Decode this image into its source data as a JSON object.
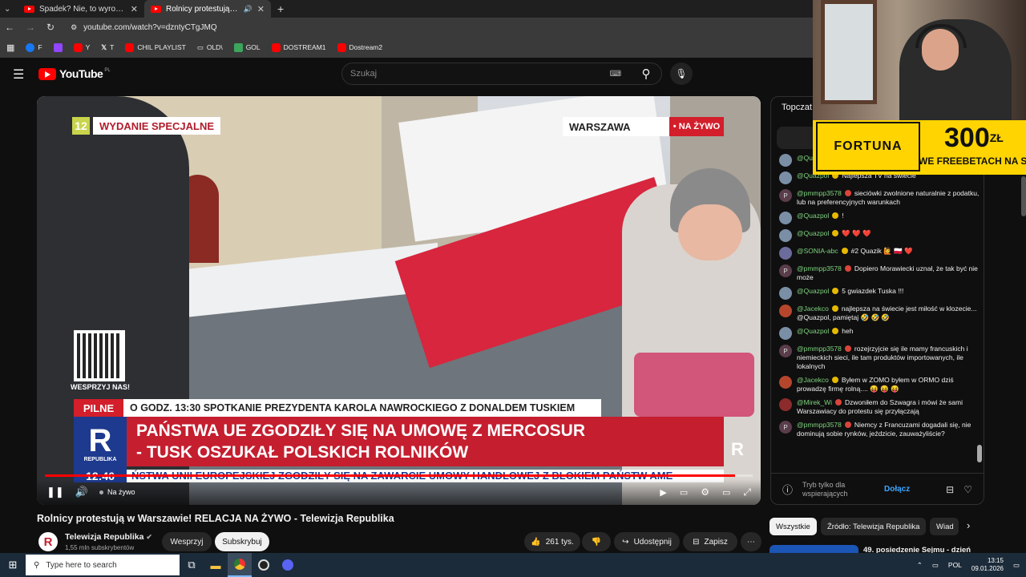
{
  "browser": {
    "tabs": [
      {
        "title": "Spadek? Nie, to wyrok! Kobieta",
        "active": false
      },
      {
        "title": "Rolnicy protestują w Warsz",
        "active": true
      }
    ],
    "url": "youtube.com/watch?v=dzntyCTgJMQ",
    "bookmarks": [
      "F",
      "Y",
      "T",
      "CHIL PLAYLIST",
      "OLD\\",
      "GOL",
      "DOSTREAM1",
      "Dostream2"
    ]
  },
  "youtube": {
    "logo": "YouTube",
    "logo_region": "PL",
    "search_placeholder": "Szukaj"
  },
  "video": {
    "channel_num": "12",
    "program_title": "WYDANIE SPECJALNE",
    "city": "WARSZAWA",
    "live_badge": "• NA ŻYWO",
    "qr_label": "WESPRZYJ NAS!",
    "pilne_label": "PILNE",
    "pilne_text": "O GODZ. 13:30  SPOTKANIE PREZYDENTA KAROLA NAWROCKIEGO Z DONALDEM TUSKIEM",
    "logo_letter": "R",
    "logo_text": "REPUBLIKA",
    "headline_1": "PAŃSTWA UE ZGODZIŁY SIĘ NA UMOWĘ Z MERCOSUR",
    "headline_2": "- TUSK OSZUKAŁ POLSKICH ROLNIKÓW",
    "time": "12:46",
    "ticker": "ŃSTWA UNII EUROPEJSKIEJ ZGODZIŁY SIĘ NA ZAWARCIE UMOWY HANDLOWEJ Z BLOKIEM PAŃSTW AME",
    "live_label": "Na żywo",
    "progress": 0.975
  },
  "meta": {
    "title": "Rolnicy protestują w Warszawie! RELACJA NA ŻYWO - Telewizja Republika",
    "channel": "Telewizja Republika",
    "subscribers": "1,55 mln subskrybentów",
    "support_btn": "Wesprzyj",
    "subscribe_btn": "Subskrybuj",
    "likes": "261 tys.",
    "share_btn": "Udostępnij",
    "save_btn": "Zapisz"
  },
  "chat": {
    "header": "Topczat",
    "messages": [
      {
        "author": "@Quazpol",
        "text": "!",
        "av": "q"
      },
      {
        "author": "@Quazpol",
        "text": "Najlepsza TV na świecie",
        "av": "q"
      },
      {
        "author": "@pmmpp3578",
        "text": "sieciówki zwolnione naturalnie z podatku, lub na preferencyjnych warunkach",
        "av": "p"
      },
      {
        "author": "@Quazpol",
        "text": "!",
        "av": "q"
      },
      {
        "author": "@Quazpol",
        "text": "❤️ ❤️ ❤️",
        "av": "q"
      },
      {
        "author": "@SONIA-abc",
        "text": "#2  Quazik 🙋 🇵🇱 ❤️",
        "av": "s"
      },
      {
        "author": "@pmmpp3578",
        "text": "Dopiero Morawiecki uznał, że tak być nie może",
        "av": "p"
      },
      {
        "author": "@Quazpol",
        "text": "5 gwiazdek Tuska !!!",
        "av": "q"
      },
      {
        "author": "@Jacekco",
        "text": "najlepsza na świecie jest miłość w klozecie... @Quazpol, pamiętaj 🤣 🤣 🤣",
        "av": "j"
      },
      {
        "author": "@Quazpol",
        "text": "heh",
        "av": "q"
      },
      {
        "author": "@pmmpp3578",
        "text": "rozejrzyjcie się ile mamy francuskich i niemieckich sieci, ile tam produktów importowanych, ile lokalnych",
        "av": "p"
      },
      {
        "author": "@Jacekco",
        "text": "Byłem w ZOMO byłem w ORMO dziś prowadzę firmę rolną.... 😝 😝 😝",
        "av": "j"
      },
      {
        "author": "@Mirek_Wi",
        "text": "Dzwoniłem do Szwagra i mówi że sami Warszawiacy do protestu się przyłączają",
        "av": "m"
      },
      {
        "author": "@pmmpp3578",
        "text": "Niemcy z Francuzami dogadali się, nie dominują sobie rynków, jeździcie, zauważyliście?",
        "av": "p"
      }
    ],
    "input_placeholder": "Tryb tylko dla wspierających",
    "join_btn": "Dołącz"
  },
  "chips": [
    "Wszystkie",
    "Źródło: Telewizja Republika",
    "Wiad"
  ],
  "rec_title": "49. posiedzenie Sejmu - dzień",
  "ad": {
    "brand": "FORTUNA",
    "amount": "300",
    "currency": "ZŁ",
    "sub": "WE FREEBETACH NA START"
  },
  "taskbar": {
    "search_placeholder": "Type here to search",
    "lang": "POL",
    "time": "13:15",
    "date": "09.01.2026"
  }
}
